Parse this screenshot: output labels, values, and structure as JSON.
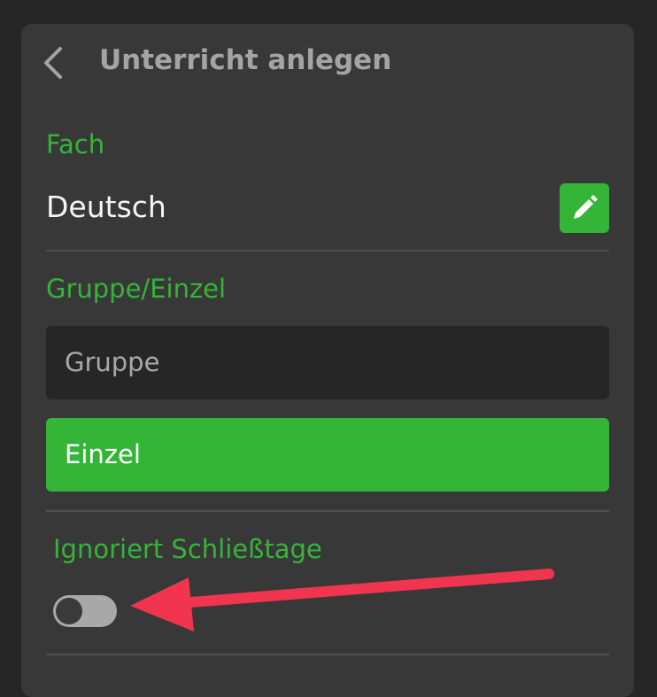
{
  "header": {
    "title": "Unterricht anlegen",
    "back_icon": "chevron-left-icon"
  },
  "fach": {
    "label": "Fach",
    "value": "Deutsch",
    "edit_icon": "pencil-icon"
  },
  "gruppe_einzel": {
    "label": "Gruppe/Einzel",
    "options": [
      {
        "label": "Gruppe",
        "selected": false
      },
      {
        "label": "Einzel",
        "selected": true
      }
    ]
  },
  "schliesstage": {
    "label": "Ignoriert Schließtage",
    "toggle_on": false
  },
  "annotation": {
    "icon": "arrow-pointer-icon",
    "color": "#f2354f"
  },
  "colors": {
    "background": "#262626",
    "panel": "#383838",
    "accent_green": "#35b537",
    "title_gray": "#a4a4a4",
    "arrow_red": "#f2354f"
  }
}
